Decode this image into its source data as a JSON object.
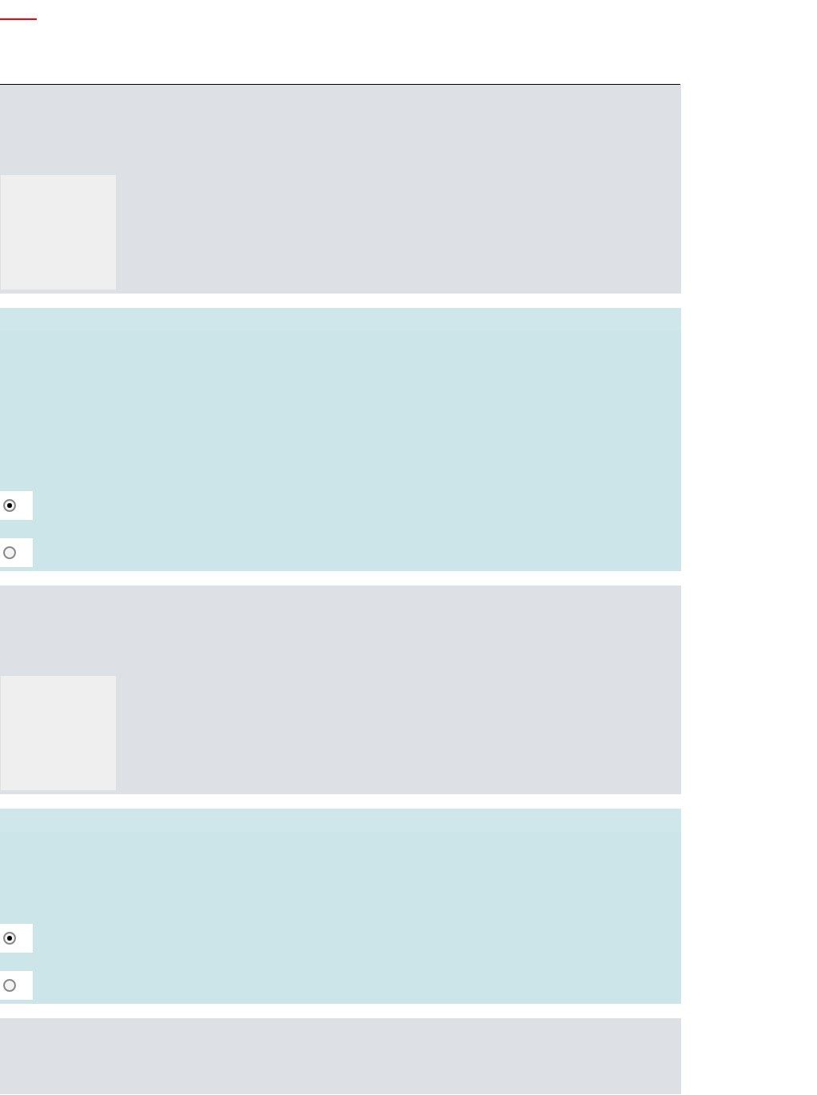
{
  "sections": [
    {
      "kind": "media"
    },
    {
      "kind": "choice",
      "options": [
        {
          "selected": true
        },
        {
          "selected": false
        }
      ]
    },
    {
      "kind": "media"
    },
    {
      "kind": "choice",
      "options": [
        {
          "selected": true
        },
        {
          "selected": false
        }
      ]
    },
    {
      "kind": "media"
    }
  ]
}
